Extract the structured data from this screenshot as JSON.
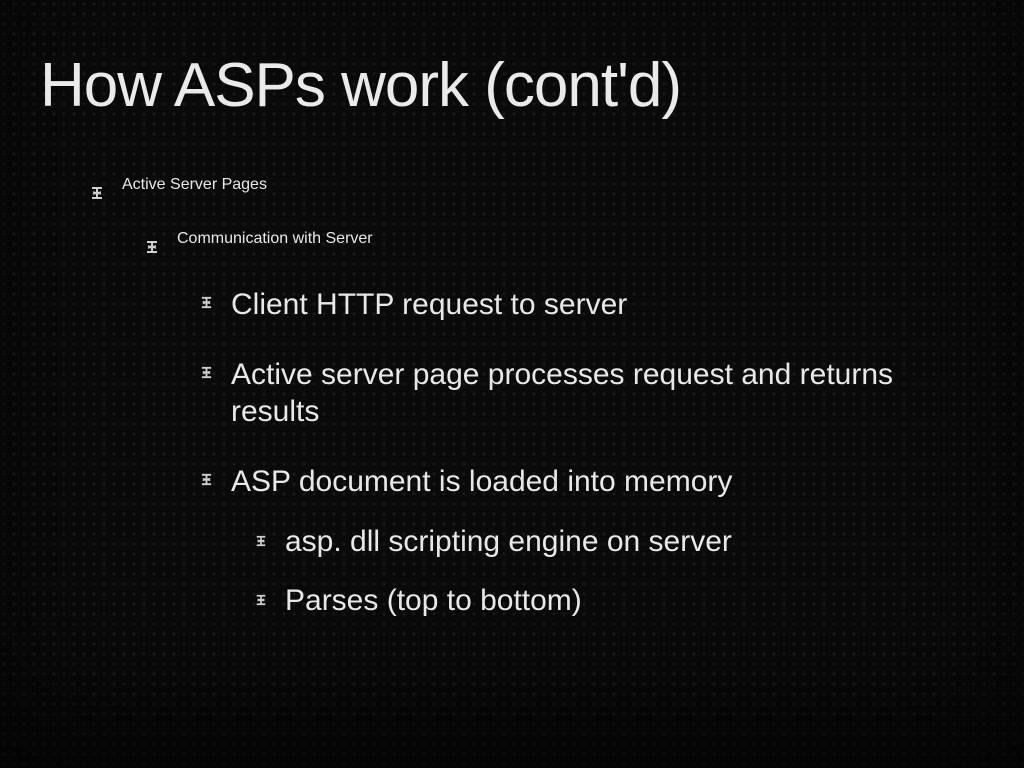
{
  "slide": {
    "title": "How ASPs work (cont'd)",
    "level1": {
      "text": "Active Server Pages"
    },
    "level2": {
      "text": "Communication with Server"
    },
    "level3": {
      "items": [
        {
          "text": "Client HTTP request to server"
        },
        {
          "text": "Active server page processes request and returns results"
        },
        {
          "text": "ASP document is loaded into memory"
        }
      ]
    },
    "level4": {
      "items": [
        {
          "text": "asp. dll scripting engine on server"
        },
        {
          "text": "Parses (top to bottom)"
        }
      ]
    }
  }
}
